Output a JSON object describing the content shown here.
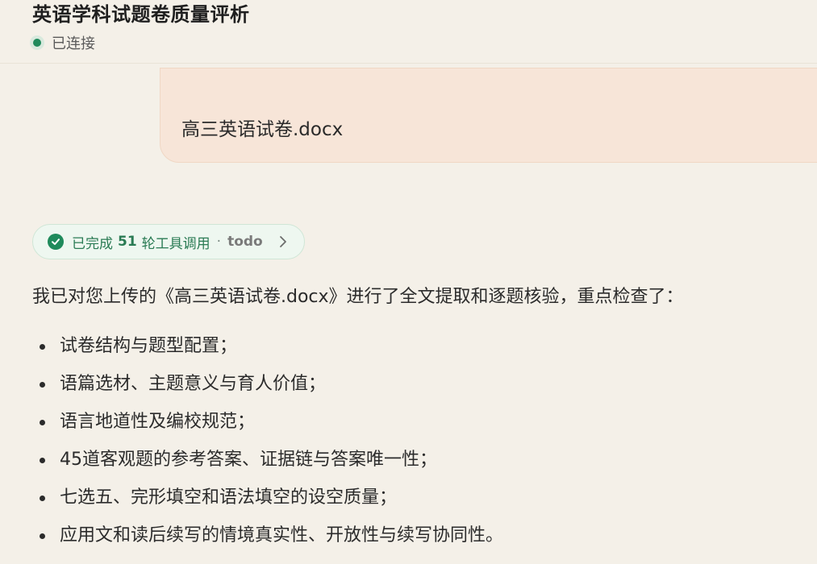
{
  "header": {
    "title": "英语学科试题卷质量评析",
    "status_label": "已连接"
  },
  "upload": {
    "filename": "高三英语试卷.docx"
  },
  "tool_summary": {
    "prefix": "已完成",
    "count": "51",
    "suffix": "轮工具调用",
    "separator": "·",
    "tag": "todo"
  },
  "message": {
    "intro": "我已对您上传的《高三英语试卷.docx》进行了全文提取和逐题核验，重点检查了：",
    "items": [
      "试卷结构与题型配置；",
      "语篇选材、主题意义与育人价值；",
      "语言地道性及编校规范；",
      "45道客观题的参考答案、证据链与答案唯一性；",
      "七选五、完形填空和语法填空的设空质量；",
      "应用文和读后续写的情境真实性、开放性与续写协同性。"
    ]
  },
  "colors": {
    "background": "#f4f0e8",
    "status_green": "#1f8a5b",
    "upload_bubble": "#f7e5d8",
    "chip_background": "#eef7f0"
  }
}
